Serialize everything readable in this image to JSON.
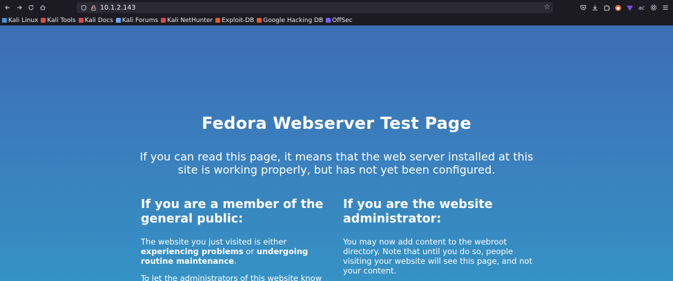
{
  "browser": {
    "url": "10.1.2.143",
    "bookmarks": [
      {
        "label": "Kali Linux",
        "color": "#4a90d9"
      },
      {
        "label": "Kali Tools",
        "color": "#d94a4a"
      },
      {
        "label": "Kali Docs",
        "color": "#d94a4a"
      },
      {
        "label": "Kali Forums",
        "color": "#6aa8ff"
      },
      {
        "label": "Kali NetHunter",
        "color": "#d94a4a"
      },
      {
        "label": "Exploit-DB",
        "color": "#e05a2a"
      },
      {
        "label": "Google Hacking DB",
        "color": "#e05a2a"
      },
      {
        "label": "OffSec",
        "color": "#7a5cff"
      }
    ]
  },
  "page": {
    "title": "Fedora Webserver Test Page",
    "lead": "If you can read this page, it means that the web server installed at this site is working properly, but has not yet been configured.",
    "public": {
      "heading": "If you are a member of the general public:",
      "p1_before": "The website you just visited is either ",
      "p1_bold1": "experiencing problems",
      "p1_mid": " or ",
      "p1_bold2": "undergoing routine maintenance",
      "p1_after": ".",
      "p2": "To let the administrators of this website know"
    },
    "admin": {
      "heading": "If you are the website administrator:",
      "p1": "You may now add content to the webroot directory. Note that until you do so, people visiting your website will see this page, and not your content."
    }
  },
  "colors": {
    "page_top": "#3c6eb4",
    "page_bottom": "#3592c4",
    "chrome": "#1c1b22"
  }
}
